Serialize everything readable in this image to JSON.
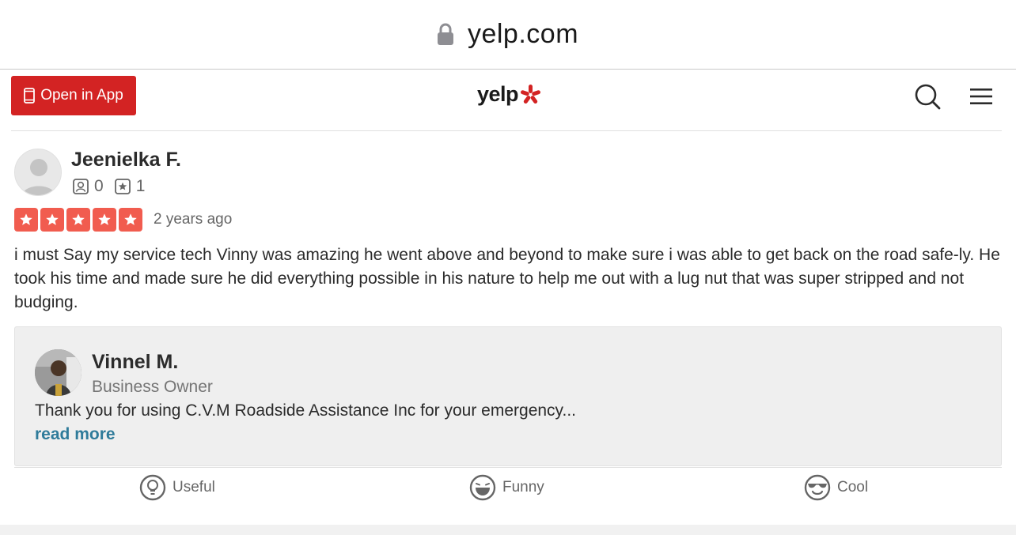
{
  "browser": {
    "url": "yelp.com"
  },
  "header": {
    "open_app_label": "Open in App",
    "logo_text": "yelp",
    "brand_color": "#d32323"
  },
  "review": {
    "author_name": "Jeenielka F.",
    "friends_count": "0",
    "reviews_count": "1",
    "rating": 5,
    "date": "2 years ago",
    "text": "i must Say my service tech Vinny was amazing he went above and beyond to make sure i was able to get back on the road safe-ly. He took his time and made sure he did everything possible in his nature to help me out with a lug nut that was super stripped and not budging."
  },
  "owner_reply": {
    "name": "Vinnel M.",
    "role": "Business Owner",
    "text": "Thank you for using C.V.M Roadside Assistance Inc for your emergency...",
    "read_more_label": "read more"
  },
  "reactions": {
    "useful_label": "Useful",
    "funny_label": "Funny",
    "cool_label": "Cool"
  },
  "colors": {
    "star": "#f15c4f",
    "link": "#2f7b9a"
  }
}
